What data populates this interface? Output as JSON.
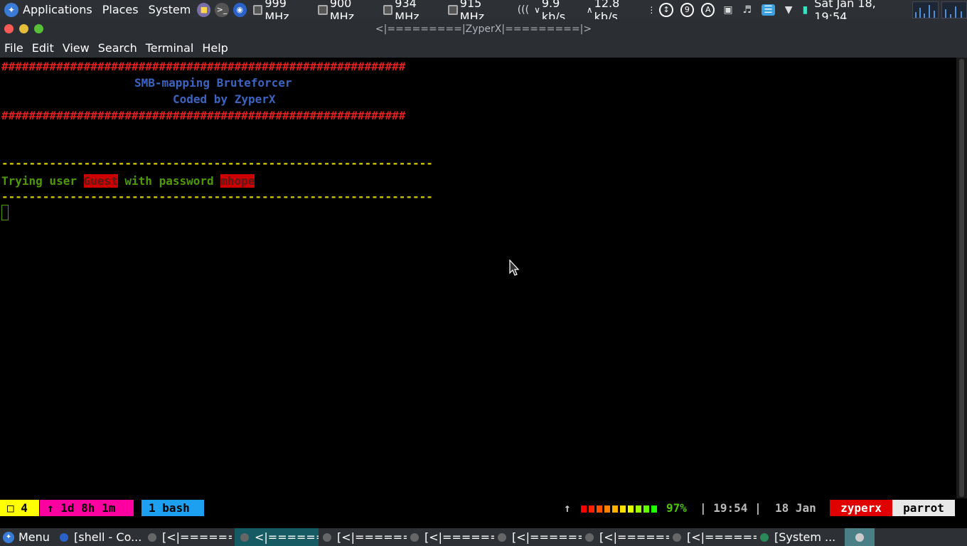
{
  "top_panel": {
    "applications": "Applications",
    "places": "Places",
    "system": "System",
    "cpu_freqs": [
      "999 MHz",
      "900 MHz",
      "934 MHz",
      "915 MHz"
    ],
    "net_down": "9.9 kb/s",
    "net_up": "12.8 kb/s",
    "badge_9": "9",
    "badge_a": "A",
    "clock": "Sat Jan 18, 19:54"
  },
  "window": {
    "title": "<|=========|ZyperX|=========|>"
  },
  "menu": {
    "file": "File",
    "edit": "Edit",
    "view": "View",
    "search": "Search",
    "terminal": "Terminal",
    "help": "Help"
  },
  "terminal": {
    "hash_line": "###########################################################",
    "banner_title": "SMB-mapping Bruteforcer",
    "banner_author": "Coded by ZyperX",
    "dash_line": "---------------------------------------------------------------",
    "trying_prefix": "Trying user ",
    "user": "Guest",
    "with_password": " with password ",
    "password": "mhope"
  },
  "tmux": {
    "windows_count": "□ 4",
    "uptime": "↑ 1d 8h 1m",
    "window_tab": "1 bash",
    "up_arrow": "↑",
    "battery_pct": "97%",
    "time": "| 19:54 |",
    "date": "18 Jan",
    "user": "zyperx",
    "host": "parrot"
  },
  "taskbar": {
    "menu": "Menu",
    "items": [
      "[shell - Co...",
      "[<|======...",
      "<|======...",
      "[<|======...",
      "[<|======...",
      "[<|======...",
      "[<|======...",
      "[<|======...",
      "[System ..."
    ]
  },
  "colors": {
    "hash_red": "#e02020",
    "banner_blue": "#3c64c0",
    "prompt_green": "#4e9a06",
    "tmux_yellow": "#ffff00",
    "tmux_magenta": "#ff00a0",
    "tmux_blue": "#1ea0f0"
  }
}
